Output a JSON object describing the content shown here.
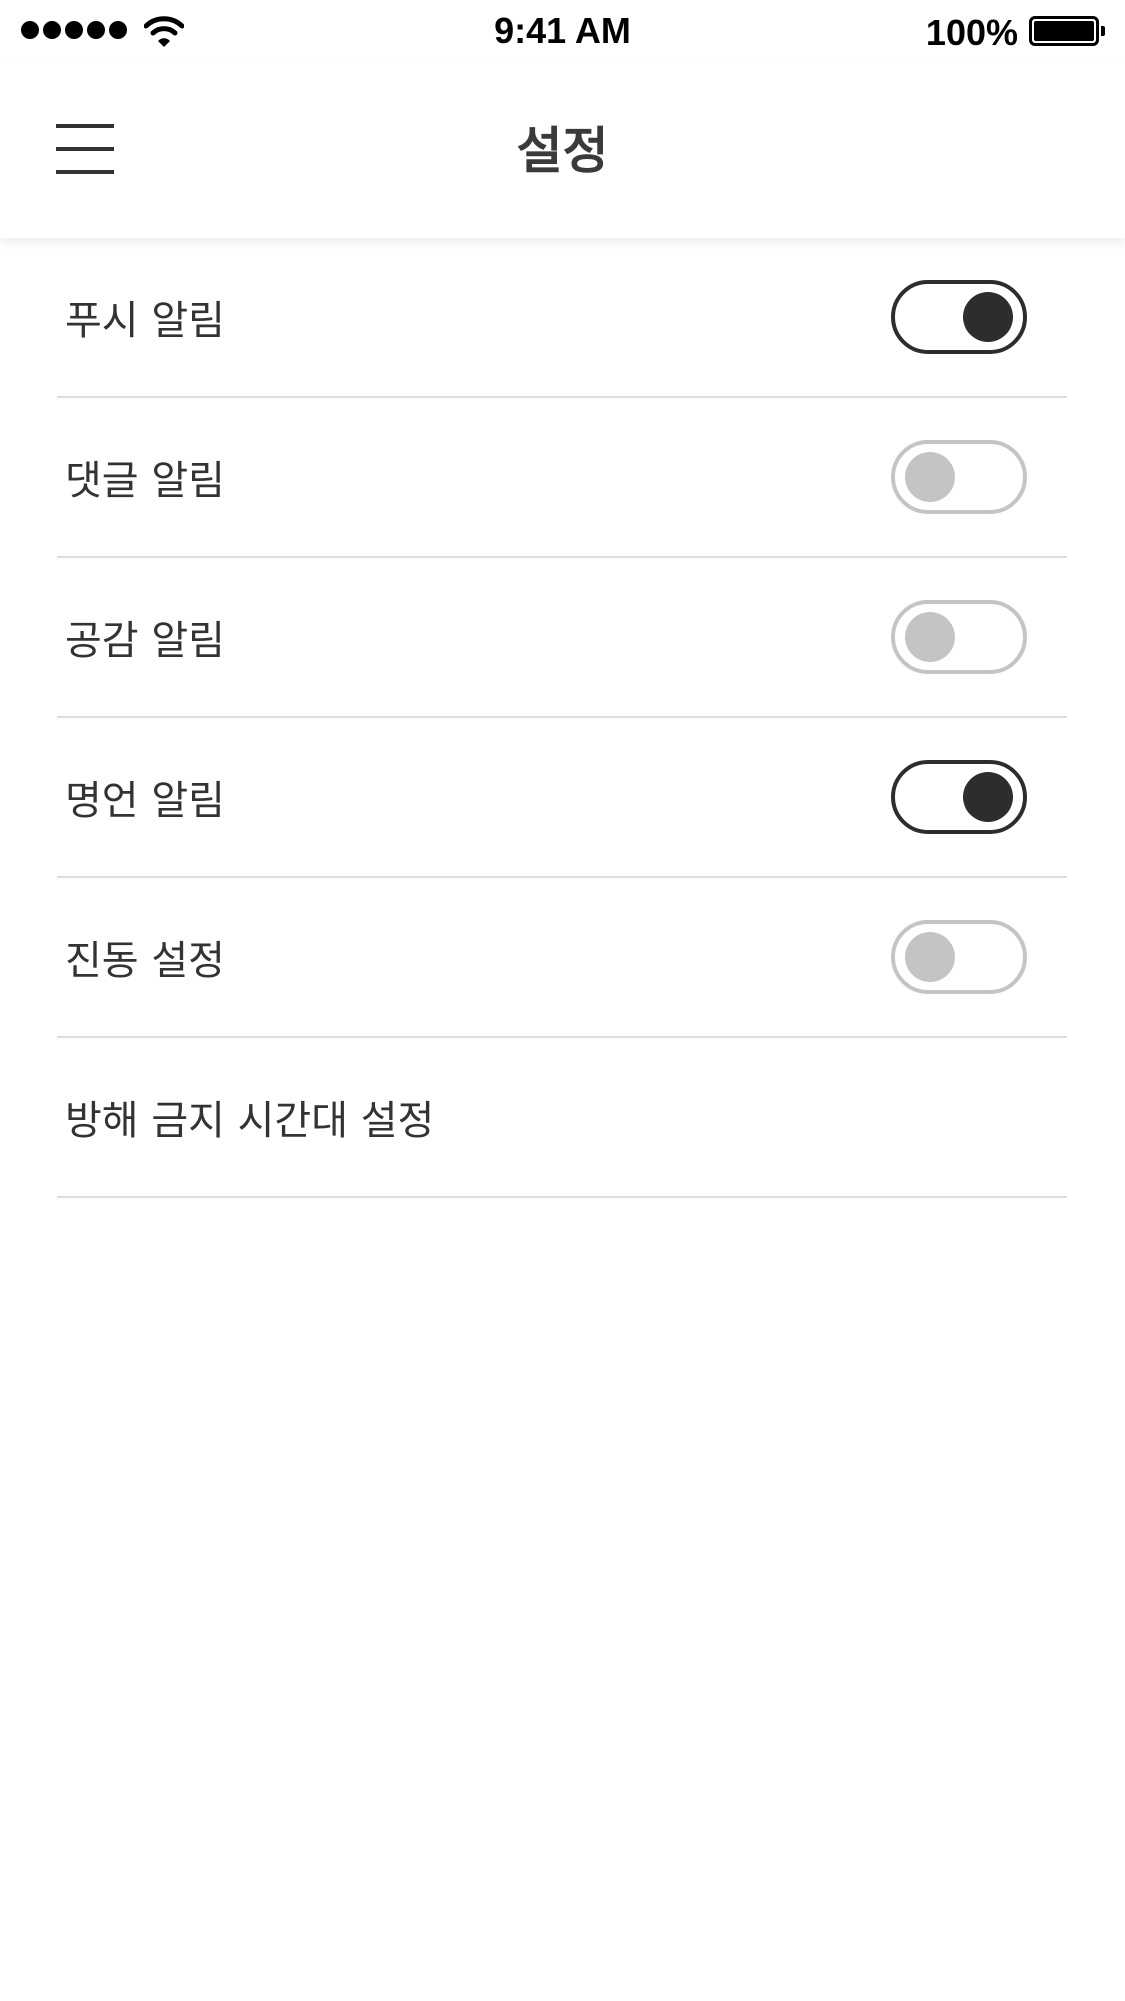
{
  "status_bar": {
    "time": "9:41 AM",
    "battery_percent": "100%",
    "icons": [
      "signal-icon",
      "wifi-icon",
      "battery-icon"
    ]
  },
  "header": {
    "title": "설정",
    "menu_icon": "hamburger-menu-icon"
  },
  "settings": [
    {
      "label": "푸시 알림",
      "toggle": true,
      "on": true
    },
    {
      "label": "댓글 알림",
      "toggle": true,
      "on": false
    },
    {
      "label": "공감 알림",
      "toggle": true,
      "on": false
    },
    {
      "label": "명언 알림",
      "toggle": true,
      "on": true
    },
    {
      "label": "진동 설정",
      "toggle": true,
      "on": false
    },
    {
      "label": "방해 금지 시간대 설정",
      "toggle": false
    }
  ],
  "colors": {
    "toggle_on": "#2d2d2d",
    "toggle_off": "#c4c4c4",
    "divider": "#dddddd",
    "text": "#333333"
  }
}
